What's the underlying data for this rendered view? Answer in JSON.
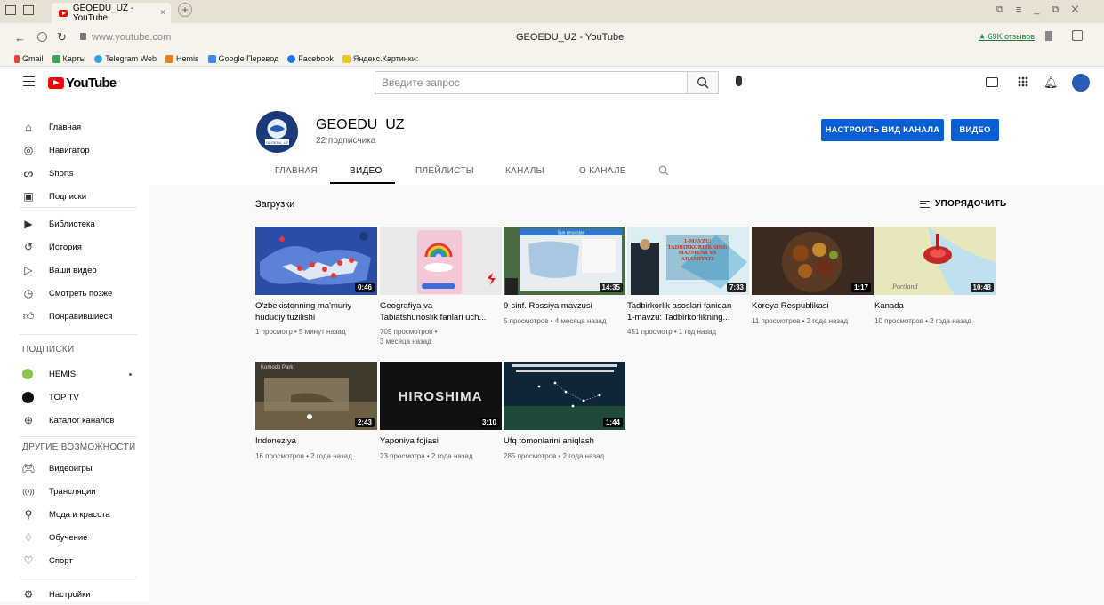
{
  "browser": {
    "tab_title": "GEOEDU_UZ - YouTube",
    "tab_close": "×",
    "new_tab": "+",
    "url": "www.youtube.com",
    "page_title": "GEOEDU_UZ - YouTube",
    "reviews": "★ 69K отзывов",
    "bookmarks": [
      "Gmail",
      "Карты",
      "Telegram Web",
      "Hemis",
      "Google Перевод",
      "Facebook",
      "Яндекс.Картинки:"
    ]
  },
  "header": {
    "logo_text": "YouTube",
    "search_placeholder": "Введите запрос"
  },
  "sidebar": {
    "main": [
      {
        "label": "Главная",
        "icon": "home-icon"
      },
      {
        "label": "Навигатор",
        "icon": "compass-icon"
      },
      {
        "label": "Shorts",
        "icon": "shorts-icon"
      },
      {
        "label": "Подписки",
        "icon": "subscriptions-icon"
      }
    ],
    "library": [
      {
        "label": "Библиотека",
        "icon": "library-icon"
      },
      {
        "label": "История",
        "icon": "history-icon"
      },
      {
        "label": "Ваши видео",
        "icon": "your-videos-icon"
      },
      {
        "label": "Смотреть позже",
        "icon": "watch-later-icon"
      },
      {
        "label": "Понравившиеся",
        "icon": "like-icon"
      }
    ],
    "subs_heading": "ПОДПИСКИ",
    "subs": [
      {
        "label": "HEMIS",
        "icon": "hemis-avatar"
      },
      {
        "label": "TOP TV",
        "icon": "toptv-avatar"
      },
      {
        "label": "Каталог каналов",
        "icon": "add-circle-icon"
      }
    ],
    "more_heading": "ДРУГИЕ ВОЗМОЖНОСТИ",
    "more": [
      {
        "label": "Видеоигры",
        "icon": "gaming-icon"
      },
      {
        "label": "Трансляции",
        "icon": "live-icon"
      },
      {
        "label": "Мода и красота",
        "icon": "hanger-icon"
      },
      {
        "label": "Обучение",
        "icon": "bulb-icon"
      },
      {
        "label": "Спорт",
        "icon": "trophy-icon"
      }
    ],
    "settings": {
      "label": "Настройки",
      "icon": "gear-icon"
    }
  },
  "channel": {
    "name": "GEOEDU_UZ",
    "subscribers": "22 подписчика",
    "avatar_text": "GEOEDU_UZ",
    "customize_button": "НАСТРОИТЬ ВИД КАНАЛА",
    "video_button": "ВИДЕО",
    "tabs": [
      "ГЛАВНАЯ",
      "ВИДЕО",
      "ПЛЕЙЛИСТЫ",
      "КАНАЛЫ",
      "О КАНАЛЕ"
    ],
    "active_tab": "ВИДЕО"
  },
  "content": {
    "section_title": "Загрузки",
    "sort_label": "УПОРЯДОЧИТЬ",
    "videos": [
      {
        "title_line1": "O'zbekistonning ma'muriy",
        "title_line2": "hududiy tuzilishi",
        "duration": "0:46",
        "meta1": "1 просмотр • 5 минут назад",
        "meta2": ""
      },
      {
        "title_line1": "Geografiya va",
        "title_line2": "Tabiatshunoslik fanlari uch...",
        "duration": "",
        "meta1": "709 просмотров •",
        "meta2": "3 месяца назад"
      },
      {
        "title_line1": "9-sinf. Rossiya mavzusi",
        "title_line2": "",
        "duration": "14:35",
        "meta1": "5 просмотров • 4 месяца назад",
        "meta2": ""
      },
      {
        "title_line1": "Tadbirkorlik asoslari fanidan",
        "title_line2": "1-mavzu: Tadbirkorlikning...",
        "duration": "7:33",
        "meta1": "451 просмотр • 1 год назад",
        "meta2": ""
      },
      {
        "title_line1": "Koreya Respublikasi",
        "title_line2": "",
        "duration": "1:17",
        "meta1": "11 просмотров • 2 года назад",
        "meta2": ""
      },
      {
        "title_line1": "Kanada",
        "title_line2": "",
        "duration": "10:48",
        "meta1": "10 просмотров • 2 года назад",
        "meta2": ""
      },
      {
        "title_line1": "Indoneziya",
        "title_line2": "",
        "duration": "2:43",
        "meta1": "16 просмотров • 2 года назад",
        "meta2": ""
      },
      {
        "title_line1": "Yaponiya fojiasi",
        "title_line2": "",
        "duration": "3:10",
        "meta1": "23 просмотра • 2 года назад",
        "meta2": ""
      },
      {
        "title_line1": "Ufq tomonlarini aniqlash",
        "title_line2": "",
        "duration": "1:44",
        "meta1": "285 просмотров • 2 года назад",
        "meta2": ""
      }
    ],
    "thumb_texts": {
      "indonesia_label": "Komodo Park",
      "hiroshima": "HIROSHIMA",
      "canada_label": "Portland",
      "tadbir_text": "1-MAVZU: TADBIRKORLIKNING MAZMUNI VA AHAMIYATI",
      "rossiya_header": "Sun resurslari"
    }
  },
  "colors": {
    "accent_blue": "#065fd4",
    "youtube_red": "#ff0000"
  }
}
